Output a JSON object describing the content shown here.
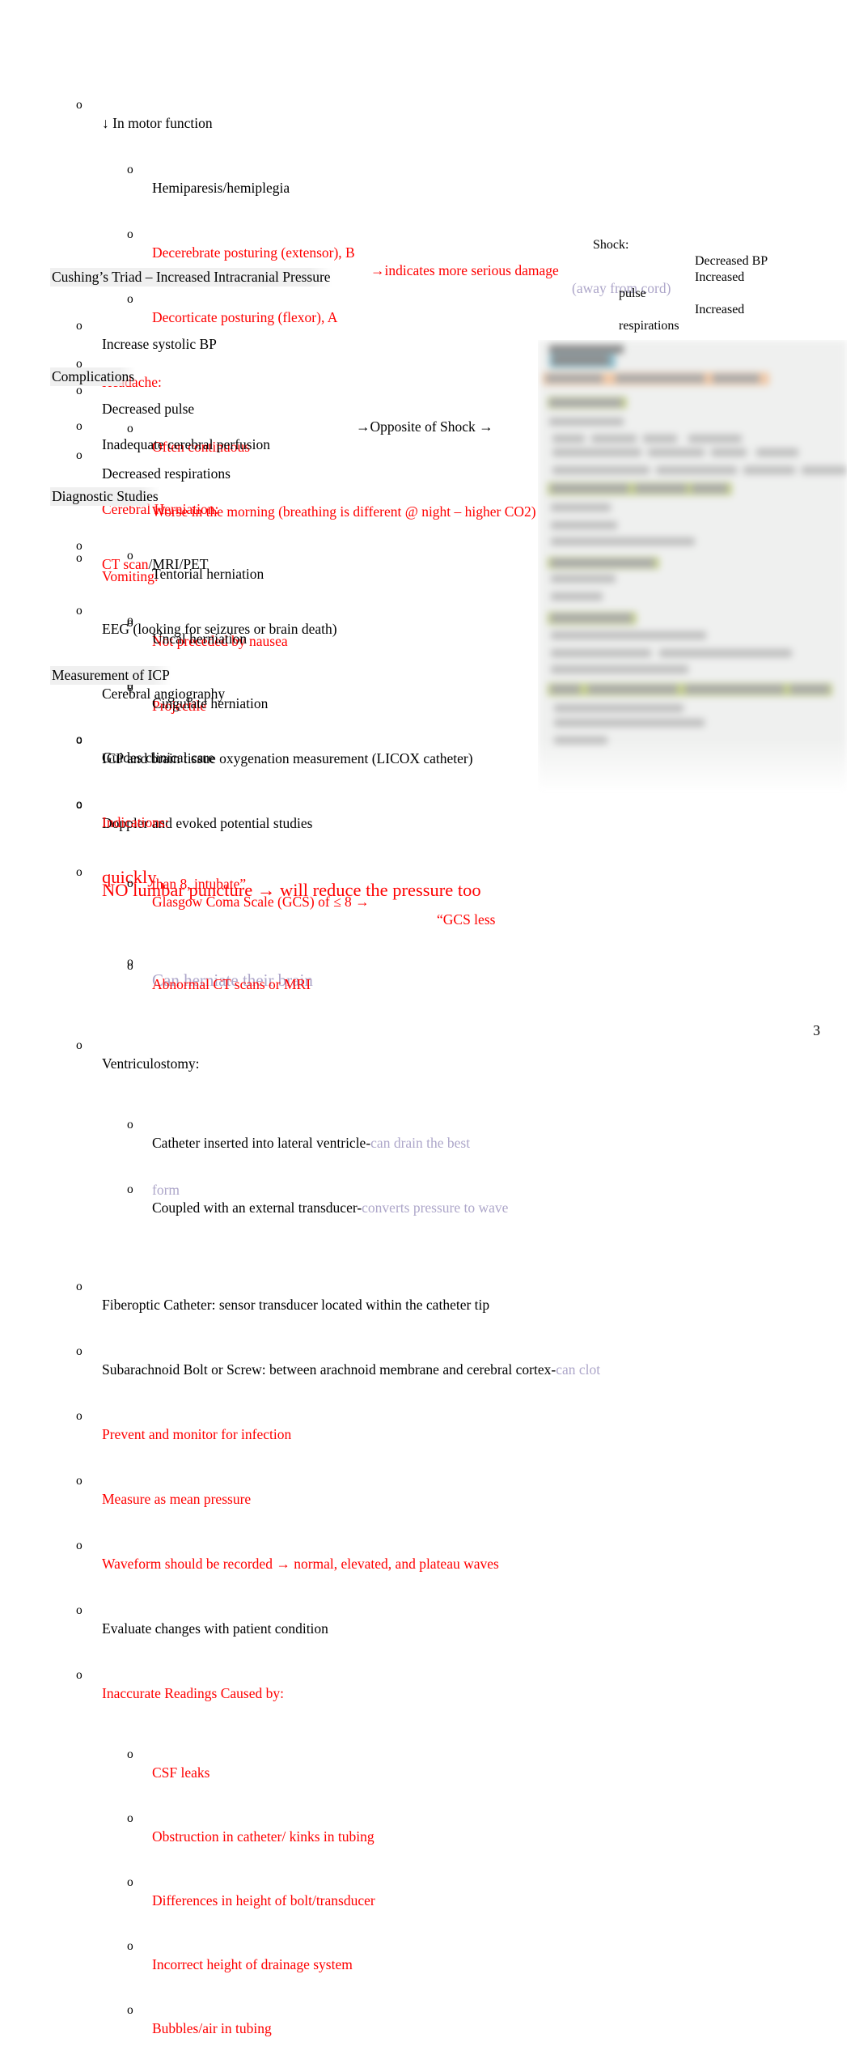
{
  "document": {
    "page_number": "3",
    "colors": {
      "red": "#FF0000",
      "black": "#000000",
      "lavender": "#ADA6C9",
      "heading_highlight": "#F0F0F0"
    },
    "bullet_marker": "o"
  },
  "motor": {
    "b1": "↓ In motor function",
    "b1_1": "Hemiparesis/hemiplegia",
    "b1_2a": "Decerebrate posturing (extensor), B",
    "b1_2b": "→indicates more serious damage",
    "b1_2c": "(away from cord)",
    "b1_3": "Decorticate posturing (flexor), A",
    "b2": "Headache:",
    "b2_1": "Often continuous",
    "b2_2": "Worse in the morning (breathing is different @ night – higher CO2)",
    "b3": "Vomiting:",
    "b3_1": "Not preceded by nausea",
    "b3_2": "Projectile"
  },
  "cushing": {
    "heading": "Cushing’s Triad – Increased Intracranial Pressure",
    "items": [
      "Increase systolic BP",
      "Decreased pulse",
      "Decreased respirations"
    ],
    "middle_note": "→Opposite of Shock →"
  },
  "shock": {
    "title": "Shock:",
    "line_bp": "Decreased BP",
    "line_inc1": "Increased",
    "line_pulse": "pulse",
    "line_inc2": "Increased",
    "line_resp": "respirations"
  },
  "complications": {
    "heading": "Complications",
    "items": [
      "Inadequate cerebral perfusion",
      "Cerebral Herniation:"
    ],
    "herniations": [
      "Tentorial herniation",
      "Uncal herniation",
      "Cingulate herniation"
    ]
  },
  "diagnostic": {
    "heading": "Diagnostic Studies",
    "ct_red": "CT scan",
    "ct_black": "/MRI/PET",
    "items": [
      "EEG (looking for seizures or brain death)",
      "Cerebral angiography",
      "ICP and brain tissue oxygenation measurement (LICOX catheter)",
      "Doppler  and evoked potential studies"
    ],
    "no_lp_line1": "NO lumbar puncture    → will reduce the pressure too",
    "no_lp_line2": "quickly",
    "herniate_note": "Can herniate their brain"
  },
  "icp": {
    "heading": "Measurement of ICP",
    "guides": "Guides clinical care",
    "indications": "Indications:",
    "gcs_line1": "Glasgow Coma Scale (GCS) of ≤ 8 →",
    "gcs_quote": "“GCS less",
    "gcs_line2": "than 8, intubate”",
    "abnormal_ct": "Abnormal CT scans or MRI",
    "ventriculostomy": "Ventriculostomy:",
    "cath_black": "Catheter inserted into lateral ventricle-",
    "cath_lav": "can drain the best",
    "transducer_black": "Coupled with an external transducer-",
    "transducer_lav": "converts pressure to wave",
    "transducer_lav2": "form",
    "fiberoptic": "Fiberoptic Catheter:    sensor transducer located within the catheter tip",
    "bolt_black": "Subarachnoid Bolt or Screw:    between arachnoid membrane and cerebral cortex-",
    "bolt_lav": "can clot",
    "prevent": "Prevent and monitor for infection",
    "mean_pressure": "Measure as mean pressure",
    "waveform": "Waveform should be recorded    → normal, elevated, and plateau waves",
    "evaluate": "Evaluate changes with patient condition",
    "inaccurate": "Inaccurate Readings Caused by:",
    "causes": [
      "CSF leaks",
      "Obstruction in catheter/ kinks in tubing",
      "Differences in height of bolt/transducer",
      "Incorrect height of drainage system",
      "Bubbles/air in tubing"
    ]
  },
  "slide_image": {
    "description": "blurred-lecture-slide-screenshot"
  }
}
